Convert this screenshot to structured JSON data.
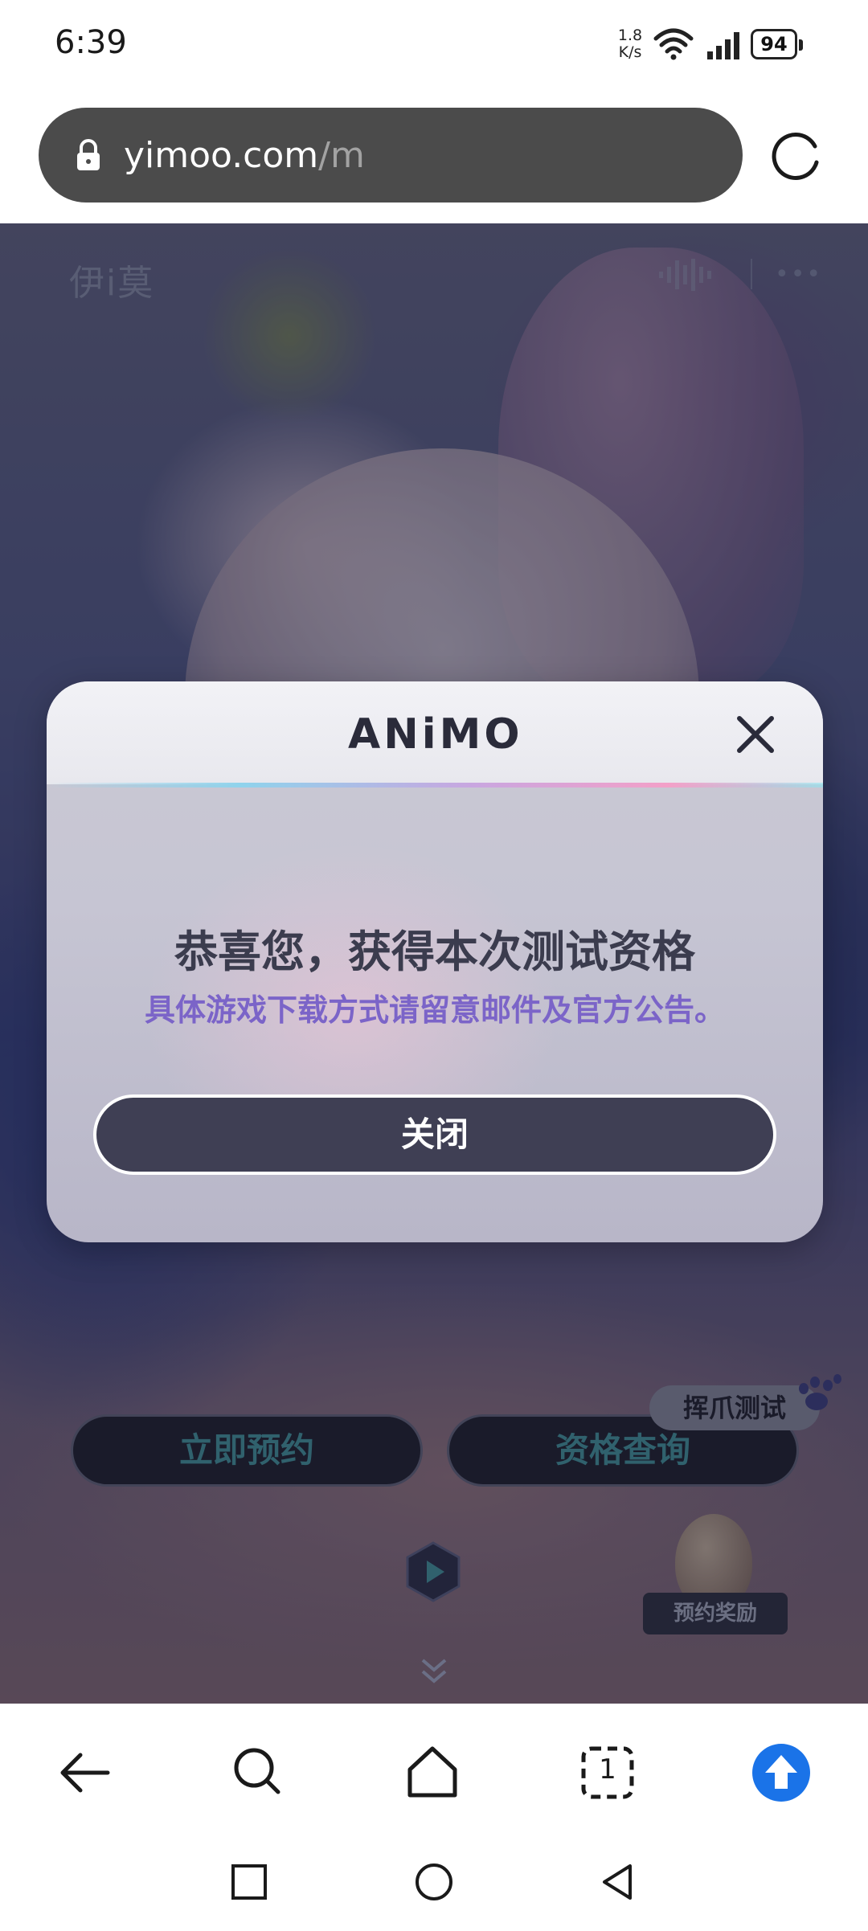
{
  "status_bar": {
    "time": "6:39",
    "net_speed_value": "1.8",
    "net_speed_unit": "K/s",
    "battery": "94"
  },
  "address_bar": {
    "url_host": "yimoo.com",
    "url_path": "/m"
  },
  "page": {
    "logo": "伊i莫",
    "buttons": {
      "reserve": "立即预约",
      "check": "资格查询"
    },
    "test_tag": "挥爪测试",
    "reward_ribbon": "预约奖励"
  },
  "modal": {
    "brand": "ANiMO",
    "title": "恭喜您，获得本次测试资格",
    "subtitle": "具体游戏下载方式请留意邮件及官方公告。",
    "close_button": "关闭"
  },
  "toolbar": {
    "tabs_count": "1"
  },
  "colors": {
    "accent_blue": "#1a73e8",
    "modal_subtitle": "#7b64c8",
    "modal_button": "#3f3f54",
    "page_button_text": "#3f8a93"
  },
  "icons": {
    "address_bar": [
      "lock-icon",
      "reload-icon"
    ],
    "page": [
      "audio-wave-icon",
      "more-icon",
      "paw-icon",
      "play-icon",
      "chevron-down-icon"
    ],
    "modal": [
      "close-icon"
    ],
    "toolbar": [
      "back-arrow-icon",
      "search-icon",
      "home-icon",
      "tabs-icon",
      "upload-icon"
    ],
    "system_nav": [
      "recents-icon",
      "home-circle-icon",
      "back-triangle-icon"
    ]
  }
}
